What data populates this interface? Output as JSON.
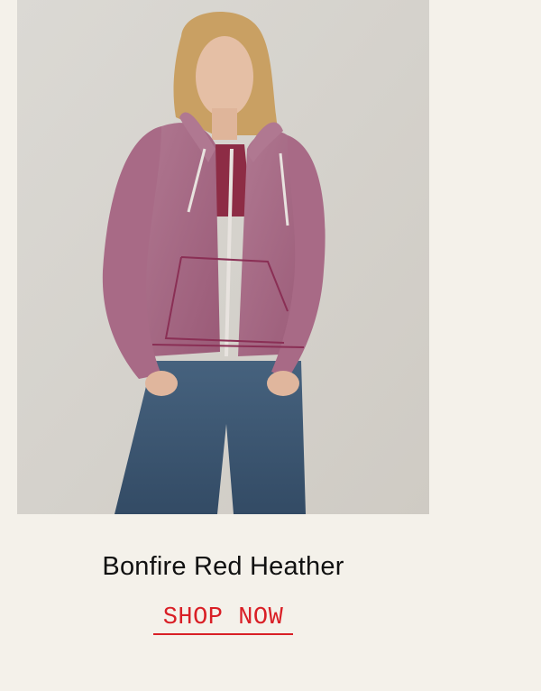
{
  "product": {
    "color_name": "Bonfire Red Heather",
    "cta_label": "SHOP NOW",
    "cta_color": "#d91f26",
    "image": {
      "icon": "product-photo-hoodie-model"
    }
  },
  "colors": {
    "page_background": "#f4f1ea",
    "photo_background": "#d9d6d0",
    "hoodie": "#a86a86",
    "denim": "#3d5874",
    "text": "#111111"
  }
}
